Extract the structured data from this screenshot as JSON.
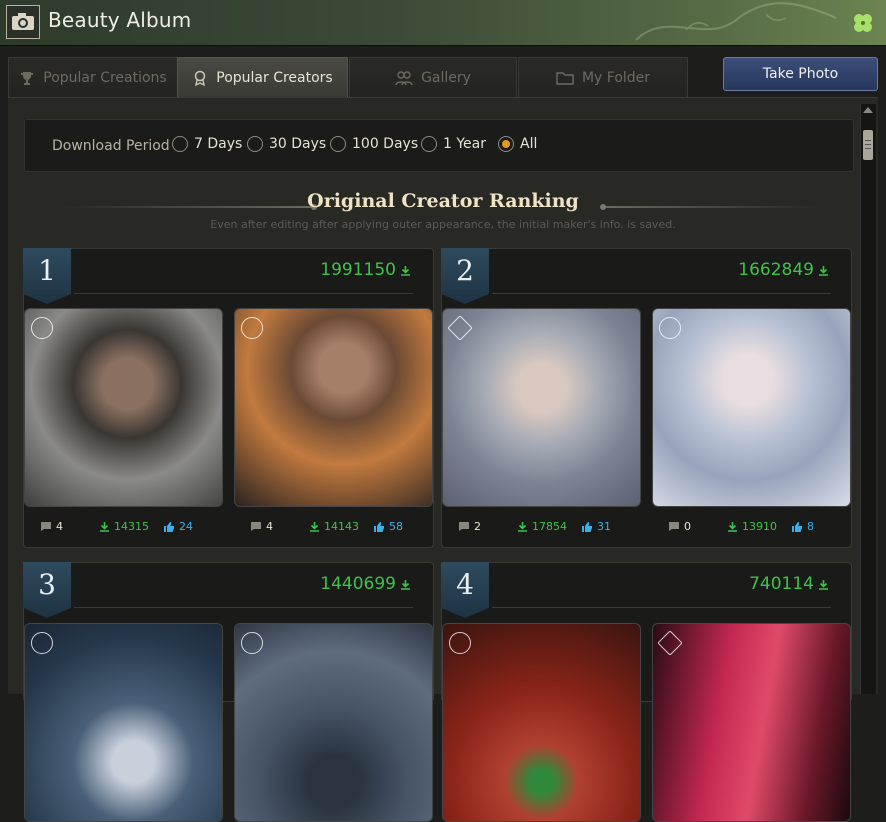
{
  "window": {
    "title": "Beauty Album"
  },
  "tabs": [
    {
      "label": "Popular Creations",
      "active": false
    },
    {
      "label": "Popular Creators",
      "active": true
    },
    {
      "label": "Gallery",
      "active": false
    },
    {
      "label": "My Folder",
      "active": false
    }
  ],
  "take_photo_label": "Take Photo",
  "filter": {
    "label": "Download Period",
    "options": [
      "7 Days",
      "30 Days",
      "100 Days",
      "1 Year",
      "All"
    ],
    "selected": "All"
  },
  "ranking": {
    "title": "Original Creator Ranking",
    "subtitle": "Even after editing after applying outer appearance, the initial maker's info. is saved.",
    "creators": [
      {
        "rank": "1",
        "total_downloads": "1991150",
        "photos": [
          {
            "comments": "4",
            "downloads": "14315",
            "likes": "24"
          },
          {
            "comments": "4",
            "downloads": "14143",
            "likes": "58"
          }
        ]
      },
      {
        "rank": "2",
        "total_downloads": "1662849",
        "photos": [
          {
            "comments": "2",
            "downloads": "17854",
            "likes": "31"
          },
          {
            "comments": "0",
            "downloads": "13910",
            "likes": "8"
          }
        ]
      },
      {
        "rank": "3",
        "total_downloads": "1440699",
        "photos": []
      },
      {
        "rank": "4",
        "total_downloads": "740114",
        "photos": []
      }
    ]
  },
  "colors": {
    "accent_green": "#3fc24a",
    "accent_blue": "#3db0e8",
    "radio_selected": "#e59a1e",
    "button_blue": "#2f4168"
  }
}
